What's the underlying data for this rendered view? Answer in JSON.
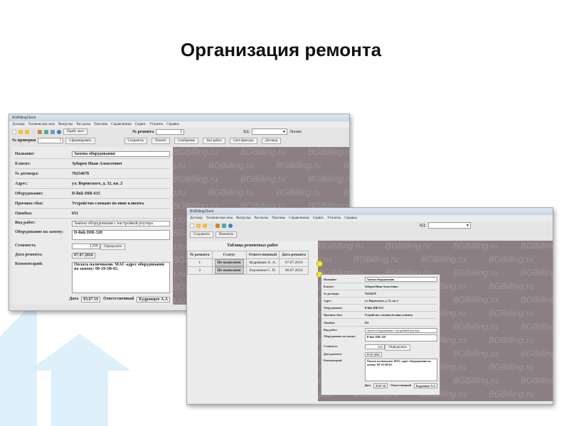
{
  "slide": {
    "title": "Организация ремонта"
  },
  "app": {
    "window_title": "BGBillingClient",
    "menu": [
      "Договор",
      "Техническая зона",
      "Выгрузка",
      "Рассылка",
      "Плагины",
      "Справочники",
      "Сервис",
      "Утилиты",
      "Справка"
    ],
    "watermark": "BGBilling.ru"
  },
  "win1": {
    "price_button": "Прайс лист",
    "repair_no_label": "№ ремонта",
    "repair_no": "1",
    "db_label": "БД:",
    "login_label": "Логин:",
    "check_no_label": "№ проверки",
    "check_no": "1",
    "form_button": "Сформировать",
    "buttons": [
      "Сохранить",
      "Ремонт",
      "Сообщение",
      "Акт работ",
      "Счет-фактура",
      "Договор"
    ],
    "form": {
      "name_label": "Название:",
      "name": "Замена оборудования",
      "client_label": "Клиент:",
      "client": "Зубарев Иван Алексеевич",
      "contract_label": "№ договора:",
      "contract": "76254678",
      "address_label": "Адрес:",
      "address": "ул. Воровского, д. 32, кв. 2",
      "equipment_label": "Оборудование:",
      "equipment": "D-link DIR-615",
      "reason_label": "Причина сбоя:",
      "reason": "Устройство сломано по вине клиента",
      "error_label": "Ошибка:",
      "error": "651",
      "work_label": "Вид работ:",
      "work": "Замена оборудования с настройкой роутера",
      "replace_label": "Оборудование на замену:",
      "replace": "D-link DIR-320",
      "cost_label": "Стоимость",
      "cost": "1250",
      "define_button": "Определить",
      "repair_date_label": "Дата ремонта:",
      "repair_date": "07.07.2016",
      "comment_label": "Комментарий:",
      "comment": "Оплата наличными. MAC-адрес оборудования на замену: 00-19-5B-65.",
      "date_label": "Дата",
      "date": "03.07.16",
      "resp_label": "Ответственный",
      "resp": "Кудрявцев А.А"
    }
  },
  "win2": {
    "buttons": [
      "Сохранить",
      "Изменить"
    ],
    "db_label": "БД:",
    "table_title": "Таблица ремонтных работ",
    "columns": [
      "№ ремонта",
      "Статус",
      "Ответственный",
      "Дата ремонта"
    ],
    "rows": [
      {
        "no": "1",
        "status": "Не выполнен",
        "resp": "Кудрявцев А. А.",
        "date": "07.07.2016"
      },
      {
        "no": "2",
        "status": "Не выполнен",
        "resp": "Борзенков С. П.",
        "date": "08.07.2016"
      }
    ],
    "mark": "?"
  },
  "colors": {
    "mauve": "#8c7f83",
    "marker": "#f3e83a"
  }
}
